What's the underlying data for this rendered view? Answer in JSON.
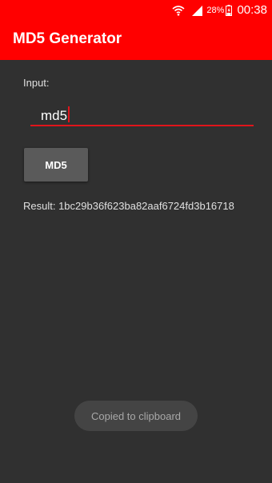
{
  "status_bar": {
    "battery_percent": "28%",
    "time": "00:38",
    "icons": [
      "wifi-icon",
      "signal-icon",
      "battery-icon"
    ]
  },
  "app_bar": {
    "title": "MD5 Generator",
    "color": "#ff0000"
  },
  "form": {
    "input_label": "Input:",
    "input_value": "md5",
    "button_label": "MD5",
    "result": "Result: 1bc29b36f623ba82aaf6724fd3b16718"
  },
  "toast": {
    "message": "Copied to clipboard"
  },
  "colors": {
    "background": "#303030",
    "accent": "#e0151b"
  }
}
